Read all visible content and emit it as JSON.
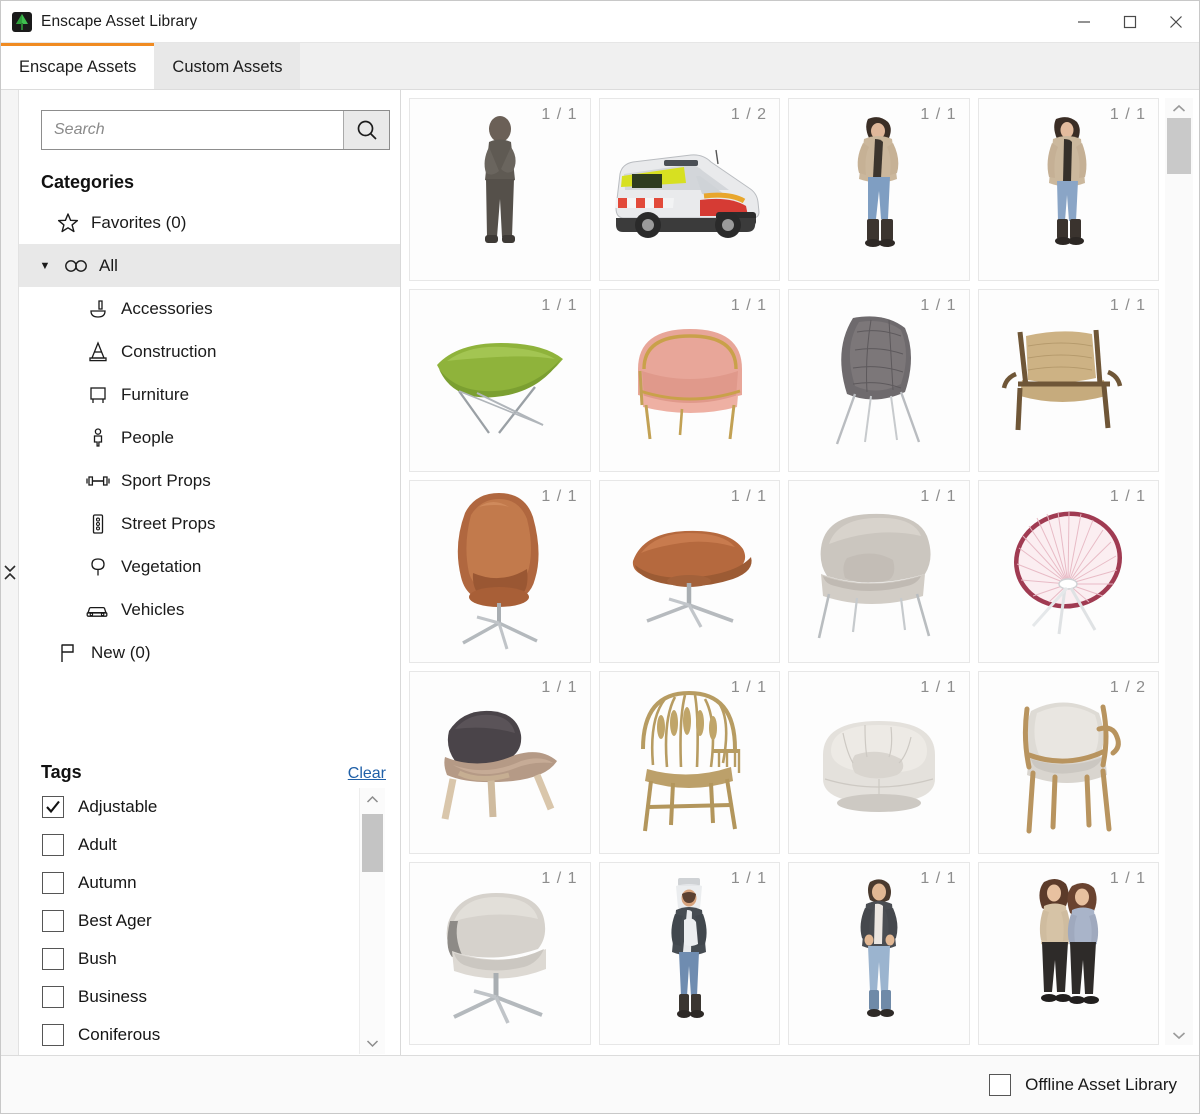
{
  "window": {
    "title": "Enscape Asset Library",
    "app_icon": "enscape-tree-icon",
    "controls": {
      "minimize": "minimize-icon",
      "maximize": "maximize-icon",
      "close": "close-icon"
    }
  },
  "tabs": [
    {
      "label": "Enscape Assets",
      "active": true
    },
    {
      "label": "Custom Assets",
      "active": false
    }
  ],
  "accent_color": "#f08b22",
  "sidebar": {
    "collapse_handle": "collapse-panel-handle",
    "search": {
      "value": "",
      "placeholder": "Search",
      "icon": "search-icon"
    },
    "categories_title": "Categories",
    "categories": [
      {
        "label": "Favorites (0)",
        "icon": "star-icon",
        "level": 0,
        "selected": false,
        "caret": ""
      },
      {
        "label": "All",
        "icon": "infinity-icon",
        "level": 0,
        "selected": true,
        "caret": "▼"
      },
      {
        "label": "Accessories",
        "icon": "accessories-icon",
        "level": 1,
        "selected": false,
        "caret": ""
      },
      {
        "label": "Construction",
        "icon": "traffic-cone-icon",
        "level": 1,
        "selected": false,
        "caret": ""
      },
      {
        "label": "Furniture",
        "icon": "furniture-icon",
        "level": 1,
        "selected": false,
        "caret": ""
      },
      {
        "label": "People",
        "icon": "person-icon",
        "level": 1,
        "selected": false,
        "caret": ""
      },
      {
        "label": "Sport Props",
        "icon": "dumbbell-icon",
        "level": 1,
        "selected": false,
        "caret": ""
      },
      {
        "label": "Street Props",
        "icon": "traffic-light-icon",
        "level": 1,
        "selected": false,
        "caret": ""
      },
      {
        "label": "Vegetation",
        "icon": "tree-icon",
        "level": 1,
        "selected": false,
        "caret": ""
      },
      {
        "label": "Vehicles",
        "icon": "car-icon",
        "level": 1,
        "selected": false,
        "caret": ""
      },
      {
        "label": "New (0)",
        "icon": "flag-icon",
        "level": 0,
        "selected": false,
        "caret": ""
      }
    ],
    "tags_title": "Tags",
    "tags_clear_label": "Clear",
    "tags": [
      {
        "label": "Adjustable",
        "checked": true
      },
      {
        "label": "Adult",
        "checked": false
      },
      {
        "label": "Autumn",
        "checked": false
      },
      {
        "label": "Best Ager",
        "checked": false
      },
      {
        "label": "Bush",
        "checked": false
      },
      {
        "label": "Business",
        "checked": false
      },
      {
        "label": "Coniferous",
        "checked": false
      }
    ]
  },
  "grid": {
    "scrollbar": {
      "up": "chevron-up-icon",
      "down": "chevron-down-icon"
    },
    "assets": [
      {
        "count": "1 / 1",
        "kind": "person-casual-gray"
      },
      {
        "count": "1 / 2",
        "kind": "ambulance-van"
      },
      {
        "count": "1 / 1",
        "kind": "person-coat-walking"
      },
      {
        "count": "1 / 1",
        "kind": "person-coat-standing"
      },
      {
        "count": "1 / 1",
        "kind": "green-coconut-chair"
      },
      {
        "count": "1 / 1",
        "kind": "pink-tub-armchair"
      },
      {
        "count": "1 / 1",
        "kind": "gray-woven-shell-chair"
      },
      {
        "count": "1 / 1",
        "kind": "wood-rattan-lounge-chair"
      },
      {
        "count": "1 / 1",
        "kind": "brown-leather-egg-chair"
      },
      {
        "count": "1 / 1",
        "kind": "brown-leather-ottoman"
      },
      {
        "count": "1 / 1",
        "kind": "gray-womb-armchair"
      },
      {
        "count": "1 / 1",
        "kind": "pink-acapulco-chair"
      },
      {
        "count": "1 / 1",
        "kind": "shell-lounge-chair"
      },
      {
        "count": "1 / 1",
        "kind": "peacock-wood-chair"
      },
      {
        "count": "1 / 1",
        "kind": "white-round-tub-chair"
      },
      {
        "count": "1 / 2",
        "kind": "wood-frame-dining-chair"
      },
      {
        "count": "1 / 1",
        "kind": "gray-swivel-lounge-chair"
      },
      {
        "count": "1 / 1",
        "kind": "person-worker-helmet"
      },
      {
        "count": "1 / 1",
        "kind": "person-woman-blazer"
      },
      {
        "count": "1 / 1",
        "kind": "two-women-walking"
      }
    ]
  },
  "footer": {
    "offline_label": "Offline Asset Library",
    "offline_checked": false
  }
}
